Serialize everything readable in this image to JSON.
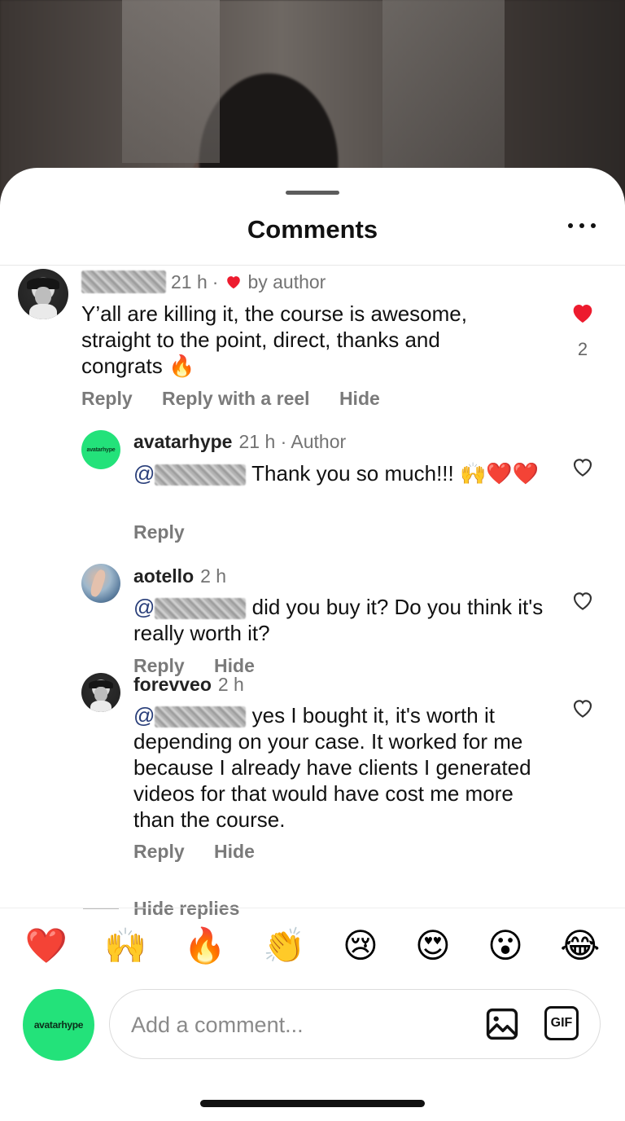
{
  "sheet": {
    "title": "Comments"
  },
  "comments": [
    {
      "time": "21 h",
      "separator": "·",
      "liked_by": "by author",
      "text": "Y’all are killing it, the course is awesome, straight to the point, direct, thanks and congrats 🔥",
      "like_count": "2",
      "actions": [
        "Reply",
        "Reply with a reel",
        "Hide"
      ]
    },
    {
      "username": "avatarhype",
      "time": "21 h · Author",
      "mention": "@",
      "text": "Thank you so much!!! 🙌❤️❤️",
      "actions": [
        "Reply"
      ]
    },
    {
      "username": "aotello",
      "time": "2 h",
      "mention": "@",
      "text": "did you buy it? Do you think it's really worth it?",
      "actions": [
        "Reply",
        "Hide"
      ]
    },
    {
      "username": "forevveo",
      "time": "2 h",
      "mention": "@",
      "text": "yes I bought it, it's worth it depending on your case. It worked for me because I already have clients I generated videos for that would have cost me more than the course.",
      "actions": [
        "Reply",
        "Hide"
      ]
    }
  ],
  "hide_replies": "Hide replies",
  "emoji_bar": [
    "❤️",
    "🙌",
    "🔥",
    "👏",
    "😢",
    "😍",
    "😮",
    "😂"
  ],
  "composer": {
    "avatar_label": "avatarhype",
    "placeholder": "Add a comment...",
    "gif_label": "GIF"
  },
  "colors": {
    "brand_green": "#23e27a",
    "like_red": "#ed1b2e",
    "mention_blue": "#2a3f7a"
  }
}
